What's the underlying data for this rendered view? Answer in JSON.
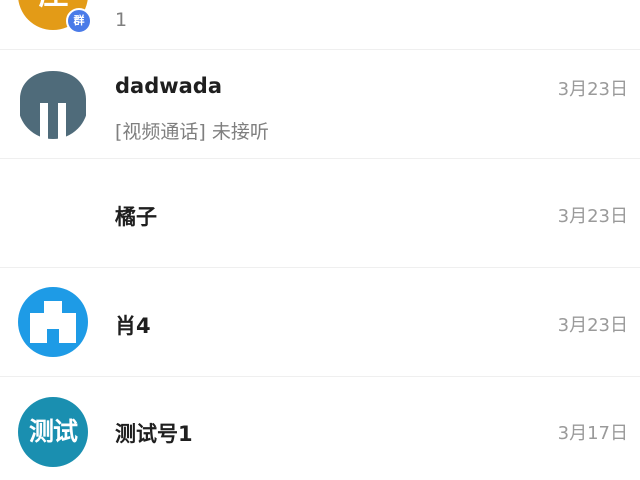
{
  "conversations": [
    {
      "name": "",
      "preview": "1",
      "time": "",
      "avatar": {
        "type": "group",
        "color": "#e39b17",
        "glyph": "庄",
        "badge": "群",
        "badge_color": "#4a7be8"
      }
    },
    {
      "name": "dadwada",
      "preview": "[视频通话] 未接听",
      "time": "3月23日",
      "avatar": {
        "type": "image",
        "color": "#4f6b7a",
        "icon": "pillar-icon"
      }
    },
    {
      "name": "橘子",
      "preview": "",
      "time": "3月23日",
      "avatar": {
        "type": "none"
      }
    },
    {
      "name": "肖4",
      "preview": "",
      "time": "3月23日",
      "avatar": {
        "type": "image",
        "color": "#1e9be6",
        "icon": "cross-block-icon"
      }
    },
    {
      "name": "测试号1",
      "preview": "",
      "time": "3月17日",
      "avatar": {
        "type": "text",
        "color": "#1a8fb0",
        "text": "测试"
      }
    }
  ]
}
